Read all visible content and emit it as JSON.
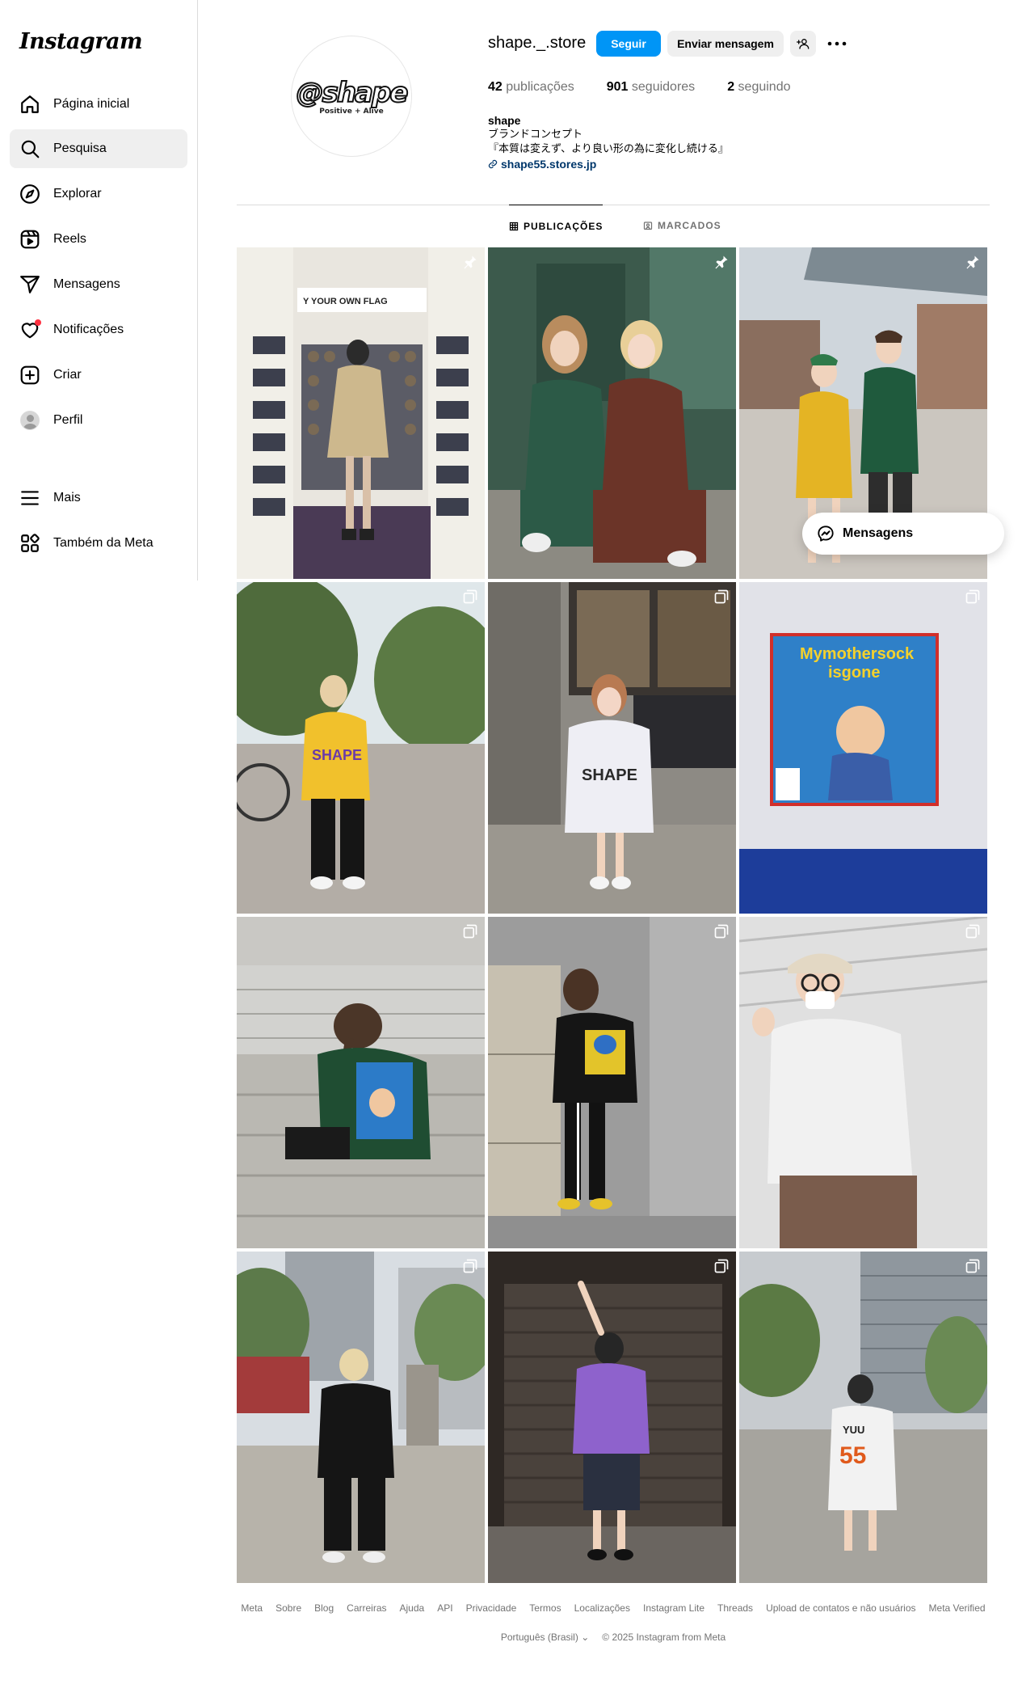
{
  "sidebar": {
    "logo": "Instagram",
    "items": [
      {
        "label": "Página inicial",
        "icon": "home-icon"
      },
      {
        "label": "Pesquisa",
        "icon": "search-icon"
      },
      {
        "label": "Explorar",
        "icon": "compass-icon"
      },
      {
        "label": "Reels",
        "icon": "reels-icon"
      },
      {
        "label": "Mensagens",
        "icon": "send-icon"
      },
      {
        "label": "Notificações",
        "icon": "heart-icon"
      },
      {
        "label": "Criar",
        "icon": "plus-square-icon"
      },
      {
        "label": "Perfil",
        "icon": "avatar"
      },
      {
        "label": "Mais",
        "icon": "menu-icon"
      },
      {
        "label": "Também da Meta",
        "icon": "apps-icon"
      }
    ]
  },
  "profile": {
    "username": "shape._.store",
    "pic_text": "@shape",
    "pic_subtext": "Positive + Alive",
    "follow_label": "Seguir",
    "message_label": "Enviar mensagem",
    "posts_count": "42",
    "posts_label": "publicações",
    "followers_count": "901",
    "followers_label": "seguidores",
    "following_count": "2",
    "following_label": "seguindo",
    "bio_name": "shape",
    "bio_line1": "ブランドコンセプト",
    "bio_line2": "『本質は変えず、より良い形の為に変化し続ける』",
    "bio_link": "shape55.stores.jp"
  },
  "tabs": {
    "posts": "PUBLICAÇÕES",
    "tagged": "MARCADOS"
  },
  "posts": [
    {
      "badge": "pin-icon"
    },
    {
      "badge": "pin-icon"
    },
    {
      "badge": "pin-icon"
    },
    {
      "badge": "carousel-icon"
    },
    {
      "badge": "carousel-icon"
    },
    {
      "badge": "carousel-icon"
    },
    {
      "badge": "carousel-icon"
    },
    {
      "badge": "carousel-icon"
    },
    {
      "badge": "carousel-icon"
    },
    {
      "badge": "carousel-icon"
    },
    {
      "badge": "carousel-icon"
    },
    {
      "badge": "carousel-icon"
    }
  ],
  "messages_float": "Mensagens",
  "footer": {
    "links": [
      "Meta",
      "Sobre",
      "Blog",
      "Carreiras",
      "Ajuda",
      "API",
      "Privacidade",
      "Termos",
      "Localizações",
      "Instagram Lite",
      "Threads",
      "Upload de contatos e não usuários",
      "Meta Verified"
    ],
    "language": "Português (Brasil)",
    "copyright": "© 2025 Instagram from Meta"
  }
}
